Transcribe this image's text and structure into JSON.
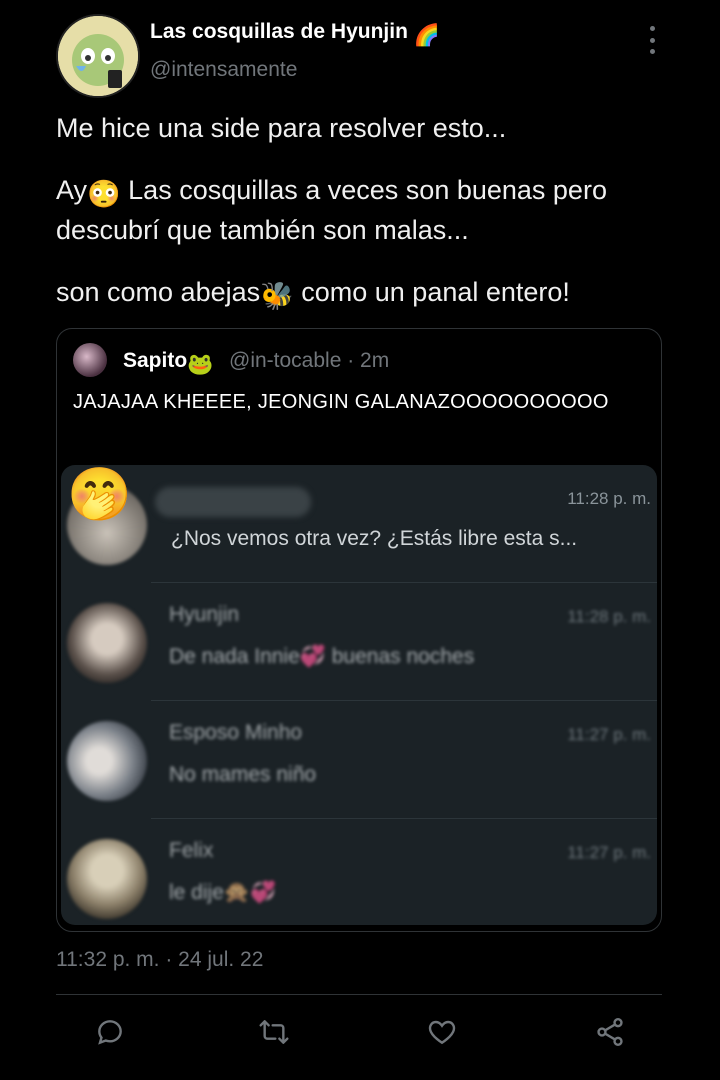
{
  "tweet": {
    "author_name": "Las cosquillas de Hyunjin",
    "author_flag_emoji": "🌈",
    "author_handle": "@intensamente",
    "text_p1": "Me hice una side para resolver esto...",
    "text_p2a": "Ay",
    "text_p2_emoji": "😳",
    "text_p2b": " Las cosquillas a veces son buenas pero descubrí que también son malas...",
    "text_p3a": "son como abejas",
    "text_p3_emoji": "🐝",
    "text_p3b": " como un panal entero!",
    "timestamp": "11:32 p. m. · 24 jul. 22"
  },
  "quote": {
    "name": "Sapito",
    "name_emoji": "🐸",
    "handle_time": "@in-tocable · 2m",
    "text": "JAJAJAA KHEEEE, JEONGIN GALANAZOOOOOOOOOO"
  },
  "chat": {
    "rows": [
      {
        "name": "",
        "time": "11:28 p. m.",
        "preview": "¿Nos vemos otra vez? ¿Estás libre esta s..."
      },
      {
        "name": "Hyunjin",
        "time": "11:28 p. m.",
        "preview": "De nada Innie💞 buenas noches"
      },
      {
        "name": "Esposo Minho",
        "time": "11:27 p. m.",
        "preview": "No mames niño"
      },
      {
        "name": "Felix",
        "time": "11:27 p. m.",
        "preview": "le dije🙊💞"
      }
    ],
    "hand_over_mouth_emoji": "🤭"
  },
  "actions": {
    "reply_icon": "reply-icon",
    "retweet_icon": "retweet-icon",
    "like_icon": "heart-icon",
    "share_icon": "share-icon"
  },
  "colors": {
    "background": "#000000",
    "secondary_text": "#71767b",
    "chat_background": "#1b2226"
  }
}
